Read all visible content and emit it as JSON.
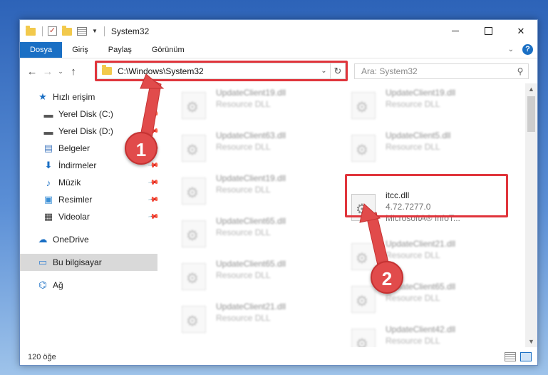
{
  "titlebar": {
    "title": "System32",
    "controls": {
      "minimize": "",
      "maximize": "",
      "close": "✕"
    }
  },
  "ribbon": {
    "tabs": [
      {
        "label": "Dosya",
        "active": true
      },
      {
        "label": "Giriş"
      },
      {
        "label": "Paylaş"
      },
      {
        "label": "Görünüm"
      }
    ],
    "help": "?"
  },
  "nav": {
    "back": "←",
    "forward": "→",
    "recent": "⌄",
    "up": "↑",
    "address": "C:\\Windows\\System32",
    "address_dropdown": "⌄",
    "refresh": "↻",
    "search_placeholder": "Ara: System32",
    "search_glyph": "⚲"
  },
  "sidebar": {
    "items": [
      {
        "label": "Hızlı erişim",
        "icon": "star-icon",
        "glyph": "★",
        "color": "#1a6fc4"
      },
      {
        "label": "Yerel Disk (C:)",
        "icon": "drive-icon",
        "glyph": "▬",
        "color": "#555555",
        "pinned": true
      },
      {
        "label": "Yerel Disk (D:)",
        "icon": "drive-icon",
        "glyph": "▬",
        "color": "#555555",
        "pinned": true
      },
      {
        "label": "Belgeler",
        "icon": "document-icon",
        "glyph": "▤",
        "color": "#4a7ec2",
        "pinned": true
      },
      {
        "label": "İndirmeler",
        "icon": "download-icon",
        "glyph": "⬇",
        "color": "#1a6fc4",
        "pinned": true
      },
      {
        "label": "Müzik",
        "icon": "music-icon",
        "glyph": "♪",
        "color": "#1a6fc4",
        "pinned": true
      },
      {
        "label": "Resimler",
        "icon": "pictures-icon",
        "glyph": "▣",
        "color": "#3a8fd6",
        "pinned": true
      },
      {
        "label": "Videolar",
        "icon": "video-icon",
        "glyph": "▦",
        "color": "#333333",
        "pinned": true
      },
      {
        "label": "OneDrive",
        "icon": "cloud-icon",
        "glyph": "☁",
        "color": "#1a6fc4"
      },
      {
        "label": "Bu bilgisayar",
        "icon": "computer-icon",
        "glyph": "▭",
        "color": "#2b7cd3",
        "selected": true
      },
      {
        "label": "Ağ",
        "icon": "network-icon",
        "glyph": "⌬",
        "color": "#1a6fc4"
      }
    ]
  },
  "files": [
    {
      "name": "UpdateClient19.dll",
      "type": "Resource DLL",
      "blurred": true
    },
    {
      "name": "UpdateClient19.dll",
      "type": "Resource DLL",
      "blurred": true
    },
    {
      "name": "UpdateClient63.dll",
      "type": "Resource DLL",
      "blurred": true
    },
    {
      "name": "UpdateClient5.dll",
      "type": "Resource DLL",
      "blurred": true
    },
    {
      "name": "UpdateClient19.dll",
      "type": "Resource DLL",
      "blurred": true
    },
    {
      "name": "itcc.dll",
      "type": "4.72.7277.0",
      "meta": "MicrosoftA® InfoT...",
      "blurred": false
    },
    {
      "name": "UpdateClient65.dll",
      "type": "Resource DLL",
      "blurred": true
    },
    {
      "name": "UpdateClient21.dll",
      "type": "Resource DLL",
      "blurred": true
    },
    {
      "name": "UpdateClient65.dll",
      "type": "Resource DLL",
      "blurred": true
    },
    {
      "name": "UpdateClient65.dll",
      "type": "Resource DLL",
      "blurred": true
    },
    {
      "name": "UpdateClient21.dll",
      "type": "Resource DLL",
      "blurred": true
    },
    {
      "name": "UpdateClient42.dll",
      "type": "Resource DLL",
      "blurred": true
    }
  ],
  "callouts": [
    {
      "label": "1"
    },
    {
      "label": "2"
    }
  ],
  "status": {
    "count": "120 öğe"
  },
  "colors": {
    "accent": "#1a6fc4",
    "highlight": "#e0353c"
  }
}
